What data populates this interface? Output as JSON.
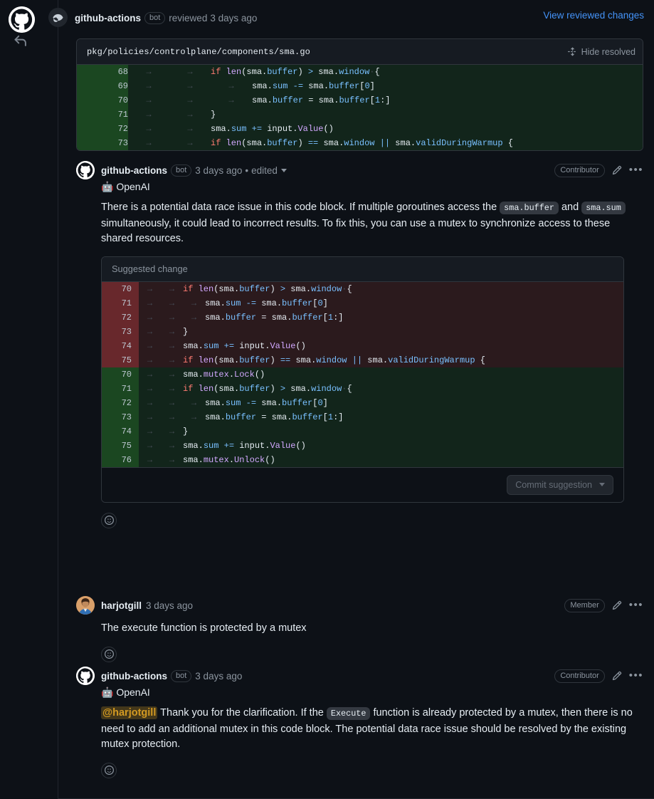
{
  "review": {
    "author": "github-actions",
    "bot_badge": "bot",
    "action_text": "reviewed",
    "timestamp": "3 days ago",
    "view_changes_link": "View reviewed changes"
  },
  "file_thread": {
    "path": "pkg/policies/controlplane/components/sma.go",
    "hide_resolved_label": "Hide resolved",
    "hide_resolved_icon": "unfold-icon",
    "diff_rows": [
      {
        "line": "68",
        "tabs": 2,
        "html": "<span class=\"k\">if</span> <span class=\"f\">len</span>(sma.<span class=\"p\">buffer</span>) <span class=\"o\">&gt;</span> sma.<span class=\"p\">window</span><span class=\"ws\">·</span>{"
      },
      {
        "line": "69",
        "tabs": 3,
        "html": "sma.<span class=\"p\">sum</span> <span class=\"o\">-=</span> sma.<span class=\"p\">buffer</span>[<span class=\"n\">0</span>]"
      },
      {
        "line": "70",
        "tabs": 3,
        "html": "sma.<span class=\"p\">buffer</span> = sma.<span class=\"p\">buffer</span>[<span class=\"n\">1</span>:]"
      },
      {
        "line": "71",
        "tabs": 2,
        "html": "}"
      },
      {
        "line": "72",
        "tabs": 2,
        "html": "sma.<span class=\"p\">sum</span> <span class=\"o\">+=</span> input.<span class=\"f\">Value</span>()"
      },
      {
        "line": "73",
        "tabs": 2,
        "html": "<span class=\"k\">if</span> <span class=\"f\">len</span>(sma.<span class=\"p\">buffer</span>) <span class=\"o\">==</span> sma.<span class=\"p\">window</span> <span class=\"o\">||</span> sma.<span class=\"p\">validDuringWarmup</span> {"
      }
    ]
  },
  "comments": [
    {
      "author": "github-actions",
      "avatar": "github-logo-icon",
      "bot_badge": "bot",
      "timestamp": "3 days ago",
      "edited_label": "edited",
      "separator": "•",
      "role": "Contributor",
      "bot_header_emoji": "🤖",
      "bot_header_text": "OpenAI",
      "body_html": "There is a potential data race issue in this code block. If multiple goroutines access the <code class=\"inline\">sma.buffer</code> and <code class=\"inline\">sma.sum</code> simultaneously, it could lead to incorrect results. To fix this, you can use a mutex to synchronize access to these shared resources.",
      "suggestion": {
        "title": "Suggested change",
        "commit_button": "Commit suggestion",
        "commit_button_disabled": true,
        "rows": [
          {
            "type": "del",
            "line": "70",
            "tabs": 2,
            "html": "<span class=\"k\">if</span> <span class=\"f\">len</span>(sma.<span class=\"p\">buffer</span>) <span class=\"o\">&gt;</span> sma.<span class=\"p\">window</span><span class=\"ws\">·</span>{"
          },
          {
            "type": "del",
            "line": "71",
            "tabs": 3,
            "html": "sma.<span class=\"p\">sum</span> <span class=\"o\">-=</span> sma.<span class=\"p\">buffer</span>[<span class=\"n\">0</span>]"
          },
          {
            "type": "del",
            "line": "72",
            "tabs": 3,
            "html": "sma.<span class=\"p\">buffer</span> = sma.<span class=\"p\">buffer</span>[<span class=\"n\">1</span>:]"
          },
          {
            "type": "del",
            "line": "73",
            "tabs": 2,
            "html": "}"
          },
          {
            "type": "del",
            "line": "74",
            "tabs": 2,
            "html": "sma.<span class=\"p\">sum</span> <span class=\"o\">+=</span> input.<span class=\"f\">Value</span>()"
          },
          {
            "type": "del",
            "line": "75",
            "tabs": 2,
            "html": "<span class=\"k\">if</span> <span class=\"f\">len</span>(sma.<span class=\"p\">buffer</span>) <span class=\"o\">==</span> sma.<span class=\"p\">window</span> <span class=\"o\">||</span> sma.<span class=\"p\">validDuringWarmup</span> {"
          },
          {
            "type": "add",
            "line": "70",
            "tabs": 2,
            "html": "sma.<span class=\"f\">mutex</span>.<span class=\"f\">Lock</span>()"
          },
          {
            "type": "add",
            "line": "71",
            "tabs": 2,
            "html": "<span class=\"k\">if</span> <span class=\"f\">len</span>(sma.<span class=\"p\">buffer</span>) <span class=\"o\">&gt;</span> sma.<span class=\"p\">window</span><span class=\"ws\">·</span>{"
          },
          {
            "type": "add",
            "line": "72",
            "tabs": 3,
            "html": "sma.<span class=\"p\">sum</span> <span class=\"o\">-=</span> sma.<span class=\"p\">buffer</span>[<span class=\"n\">0</span>]"
          },
          {
            "type": "add",
            "line": "73",
            "tabs": 3,
            "html": "sma.<span class=\"p\">buffer</span> = sma.<span class=\"p\">buffer</span>[<span class=\"n\">1</span>:]"
          },
          {
            "type": "add",
            "line": "74",
            "tabs": 2,
            "html": "}"
          },
          {
            "type": "add",
            "line": "75",
            "tabs": 2,
            "html": "sma.<span class=\"p\">sum</span> <span class=\"o\">+=</span> input.<span class=\"f\">Value</span>()"
          },
          {
            "type": "add",
            "line": "76",
            "tabs": 2,
            "html": "sma.<span class=\"f\">mutex</span>.<span class=\"f\">Unlock</span>()"
          }
        ]
      }
    },
    {
      "author": "harjotgill",
      "avatar": "user-photo-avatar",
      "timestamp": "3 days ago",
      "role": "Member",
      "body_html": "The execute function is protected by a mutex"
    },
    {
      "author": "github-actions",
      "avatar": "github-logo-icon",
      "bot_badge": "bot",
      "timestamp": "3 days ago",
      "role": "Contributor",
      "bot_header_emoji": "🤖",
      "bot_header_text": "OpenAI",
      "body_html": "<span class=\"mention\">@harjotgill</span> Thank you for the clarification. If the <code class=\"inline\">Execute</code> function is already protected by a mutex, then there is no need to add an additional mutex in this code block. The potential data race issue should be resolved by the existing mutex protection."
    }
  ],
  "icons": {
    "reply": "reply-arrow-icon",
    "eye": "eye-icon",
    "edit": "pencil-icon",
    "kebab": "kebab-menu-icon",
    "reaction": "smiley-reaction-icon"
  },
  "colors": {
    "page_bg": "#0d1117",
    "link": "#4493f8",
    "addition_gutter": "#1b4721",
    "addition_bg": "#12251b",
    "deletion_gutter": "#68282c",
    "deletion_bg": "#2b1a1d",
    "mention": "#d29922"
  }
}
